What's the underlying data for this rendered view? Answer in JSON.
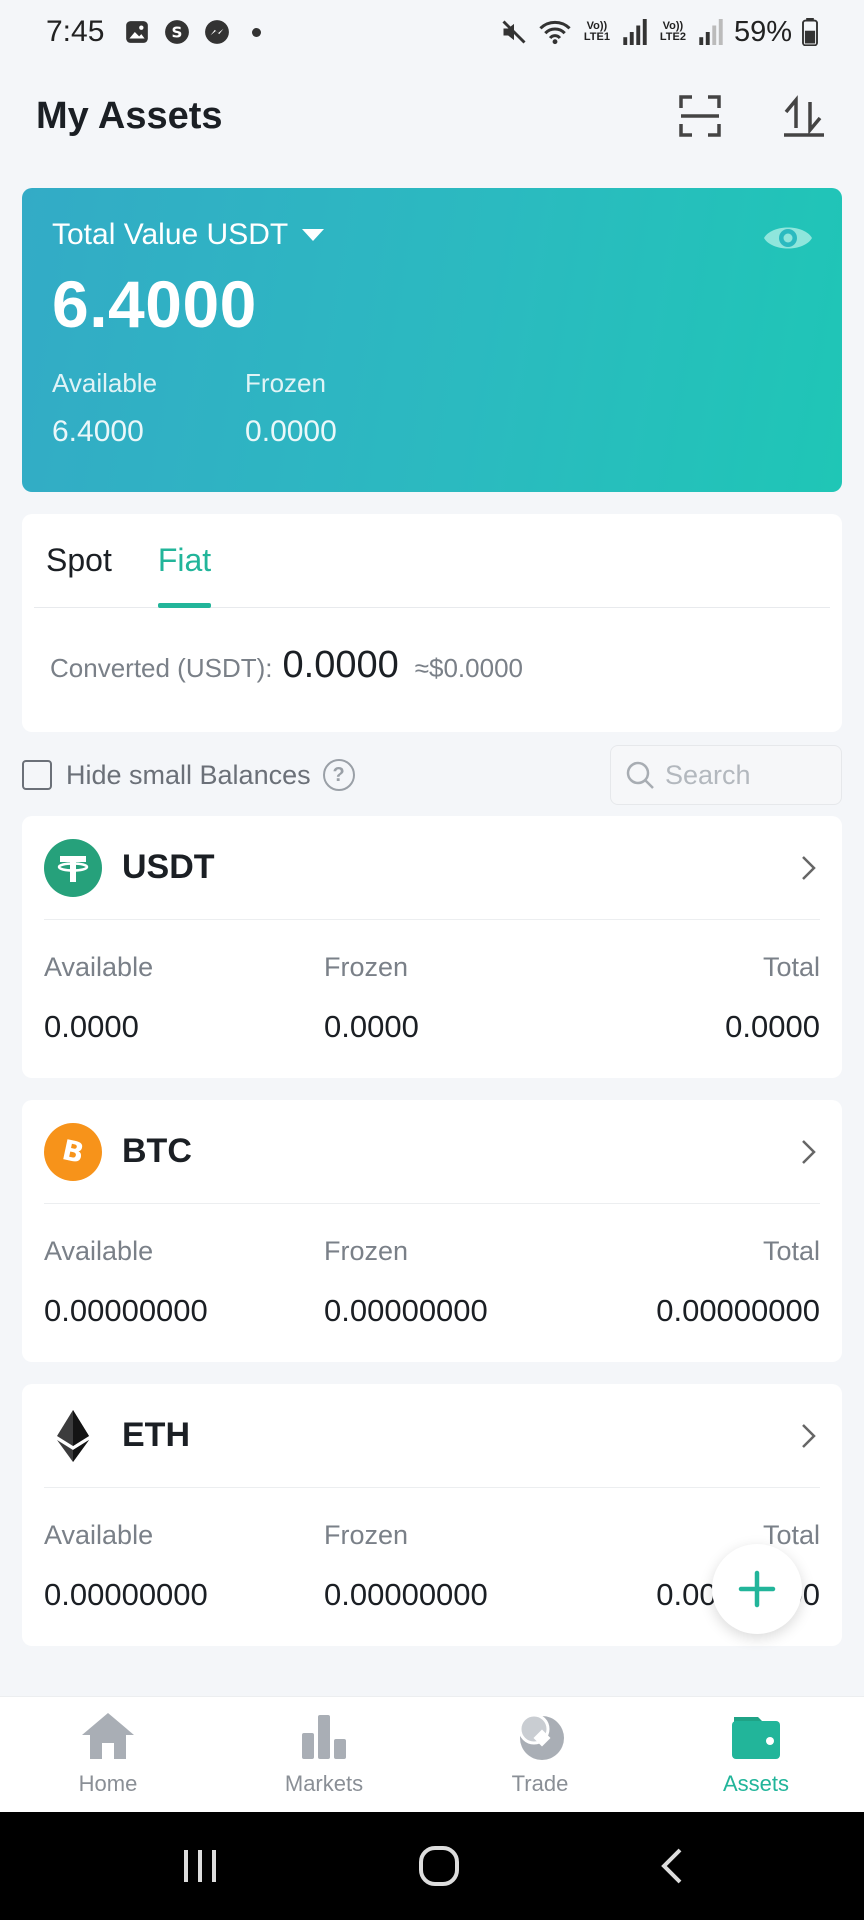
{
  "status_bar": {
    "time": "7:45",
    "sim1": "Vo)) LTE1",
    "sim2": "Vo)) LTE2",
    "battery": "59%"
  },
  "header": {
    "title": "My Assets"
  },
  "total_card": {
    "label": "Total Value USDT",
    "value": "6.4000",
    "available_label": "Available",
    "available_value": "6.4000",
    "frozen_label": "Frozen",
    "frozen_value": "0.0000"
  },
  "tabs": {
    "items": [
      {
        "label": "Spot"
      },
      {
        "label": "Fiat"
      }
    ],
    "active": "Fiat"
  },
  "converted": {
    "label": "Converted (USDT):",
    "value": "0.0000",
    "approx": "≈$0.0000"
  },
  "filter": {
    "hide_label": "Hide small Balances",
    "help": "?",
    "search_placeholder": "Search"
  },
  "assets": [
    {
      "name": "USDT",
      "available_label": "Available",
      "frozen_label": "Frozen",
      "total_label": "Total",
      "available": "0.0000",
      "frozen": "0.0000",
      "total": "0.0000",
      "color": "#26a17b"
    },
    {
      "name": "BTC",
      "available_label": "Available",
      "frozen_label": "Frozen",
      "total_label": "Total",
      "available": "0.00000000",
      "frozen": "0.00000000",
      "total": "0.00000000",
      "color": "#f7931a"
    },
    {
      "name": "ETH",
      "available_label": "Available",
      "frozen_label": "Frozen",
      "total_label": "Total",
      "available": "0.00000000",
      "frozen": "0.00000000",
      "total": "0.00000000",
      "color": "#3c3c3d"
    }
  ],
  "bottom_nav": {
    "items": [
      {
        "label": "Home",
        "icon": "home-icon"
      },
      {
        "label": "Markets",
        "icon": "bar-chart-icon"
      },
      {
        "label": "Trade",
        "icon": "trade-icon"
      },
      {
        "label": "Assets",
        "icon": "wallet-icon"
      }
    ],
    "active": "Assets"
  },
  "colors": {
    "accent": "#22b59a",
    "card_gradient_start": "#33abc6",
    "card_gradient_end": "#1fc6b6"
  }
}
